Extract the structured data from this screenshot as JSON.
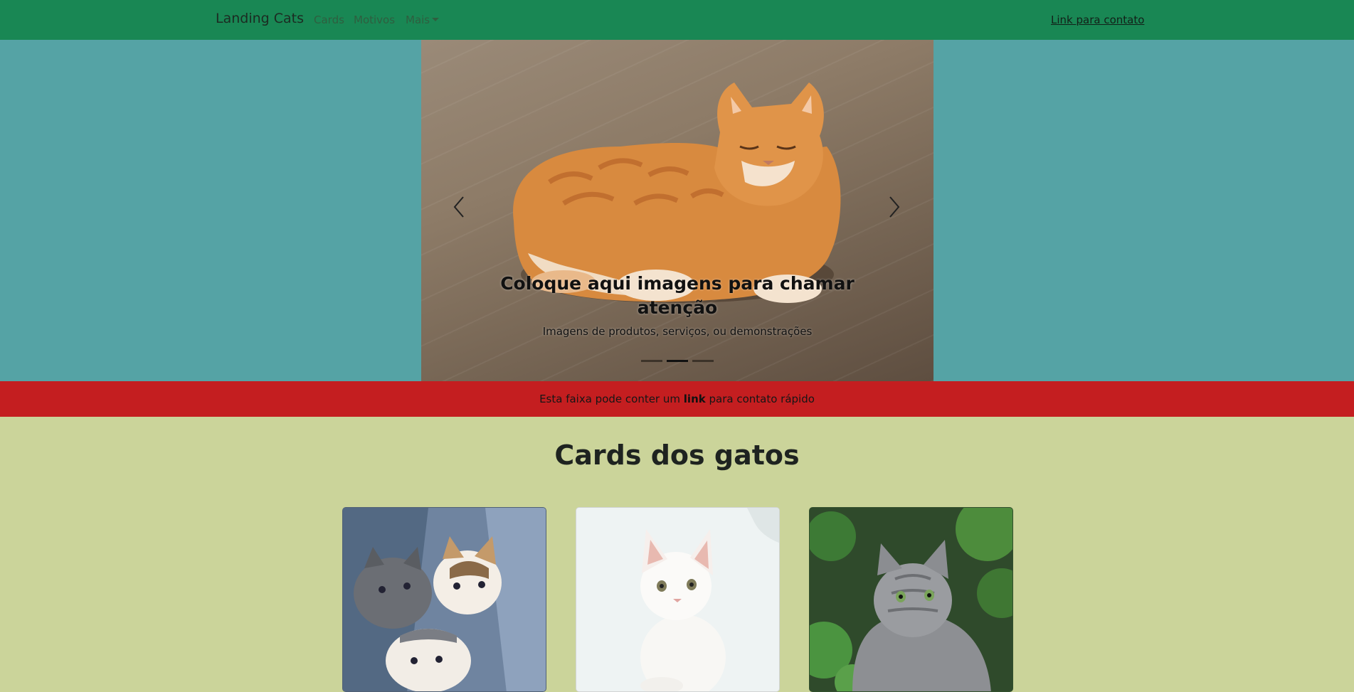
{
  "navbar": {
    "brand": "Landing Cats",
    "links": [
      {
        "label": "Cards"
      },
      {
        "label": "Motivos"
      },
      {
        "label": "Mais"
      }
    ],
    "contact": "Link para contato"
  },
  "carousel": {
    "caption_title": "Coloque aqui imagens para chamar atenção",
    "caption_text": "Imagens de produtos, serviços, ou demonstrações",
    "slide_count": 3,
    "active_index": 1
  },
  "band": {
    "prefix": "Esta faixa pode conter um",
    "link": "link",
    "suffix": "para contato rápido"
  },
  "cards_section": {
    "title": "Cards dos gatos",
    "cards": [
      {
        "image": "kittens-photo"
      },
      {
        "image": "white-cat-photo"
      },
      {
        "image": "grey-cat-photo"
      }
    ]
  },
  "colors": {
    "navbar": "#198754",
    "hero": "#55a3a5",
    "band": "#c41e20",
    "section": "#cbd49a"
  }
}
